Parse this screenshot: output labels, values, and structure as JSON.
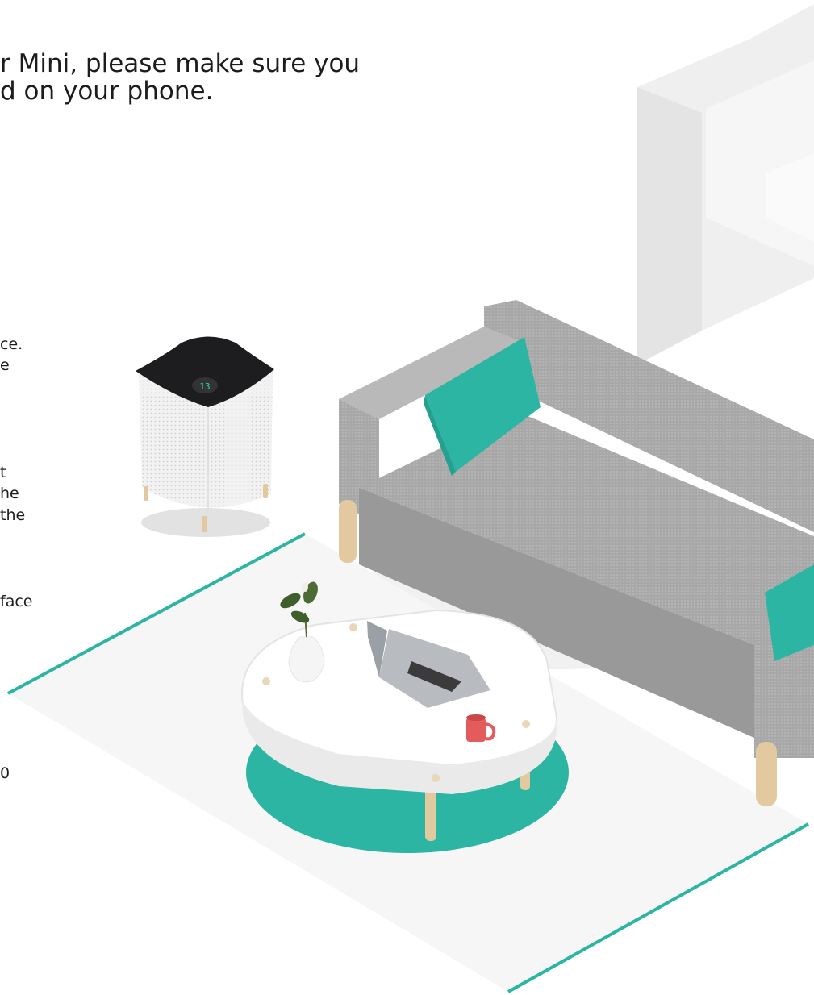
{
  "intro": {
    "line1": "r Mini, please make sure you",
    "line2": "d on your phone."
  },
  "left_text_fragments": [
    "ce.",
    "e",
    "t",
    "he",
    "the",
    "face",
    "0"
  ],
  "purifier": {
    "display_value": "13"
  },
  "colors": {
    "accent_teal": "#2bb5a2",
    "sofa_gray": "#a9a9a9",
    "purifier_top": "#1d1d1f",
    "mug_red": "#e45b5b",
    "wood": "#e3c9a0"
  }
}
